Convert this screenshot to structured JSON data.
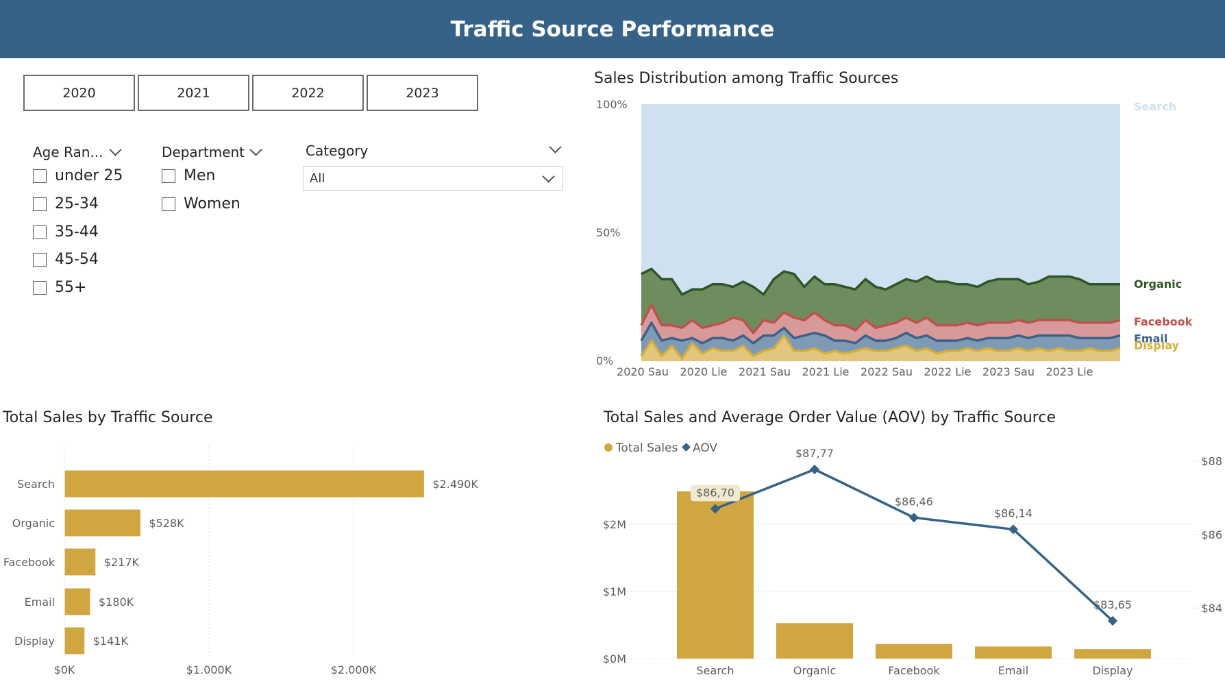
{
  "header": {
    "title": "Traffic Source Performance"
  },
  "year_buttons": [
    "2020",
    "2021",
    "2022",
    "2023"
  ],
  "slicers": {
    "age": {
      "title": "Age Ran...",
      "options": [
        "under 25",
        "25-34",
        "35-44",
        "45-54",
        "55+"
      ]
    },
    "department": {
      "title": "Department",
      "options": [
        "Men",
        "Women"
      ]
    },
    "category": {
      "title": "Category",
      "selected": "All"
    }
  },
  "colors": {
    "header": "#356286",
    "search": "#cfe0f1",
    "organic": "#2f5425",
    "organic_fill": "#6e8c5e",
    "facebook": "#c0504d",
    "facebook_fill": "#d8999a",
    "email": "#3c6288",
    "email_fill": "#7e9ab4",
    "display": "#d4ae3c",
    "display_fill": "#e3c67d",
    "bar": "#cfa640",
    "aov_line": "#356286"
  },
  "chart_data": [
    {
      "type": "area",
      "title": "Sales Distribution among Traffic Sources",
      "x_ticks": [
        "2020 Sau",
        "2020 Lie",
        "2021 Sau",
        "2021 Lie",
        "2022 Sau",
        "2022 Lie",
        "2023 Sau",
        "2023 Lie"
      ],
      "y_ticks": [
        "100%",
        "50%",
        "0%"
      ],
      "ylim": [
        0,
        100
      ],
      "stacked_percent": true,
      "series": [
        {
          "name": "Display",
          "values": [
            2,
            8,
            2,
            6,
            1,
            7,
            3,
            5,
            4,
            4,
            6,
            2,
            4,
            5,
            10,
            4,
            4,
            5,
            3,
            4,
            3,
            4,
            5,
            4,
            4,
            5,
            6,
            4,
            5,
            3,
            4,
            4,
            5,
            4,
            5,
            4,
            4,
            5,
            4,
            5,
            4,
            5,
            4,
            4,
            5,
            4,
            4,
            5
          ]
        },
        {
          "name": "Email",
          "values": [
            6,
            7,
            6,
            3,
            7,
            2,
            4,
            4,
            5,
            4,
            4,
            5,
            6,
            5,
            3,
            5,
            6,
            6,
            7,
            4,
            5,
            3,
            5,
            4,
            4,
            4,
            5,
            5,
            5,
            5,
            4,
            4,
            4,
            4,
            4,
            5,
            5,
            5,
            5,
            5,
            6,
            5,
            6,
            5,
            4,
            5,
            5,
            5
          ]
        },
        {
          "name": "Facebook",
          "values": [
            6,
            7,
            6,
            5,
            5,
            7,
            6,
            5,
            6,
            9,
            6,
            4,
            6,
            5,
            6,
            8,
            6,
            8,
            6,
            6,
            6,
            5,
            6,
            5,
            6,
            6,
            6,
            6,
            7,
            6,
            6,
            6,
            6,
            6,
            6,
            6,
            6,
            6,
            6,
            6,
            6,
            6,
            6,
            6,
            6,
            6,
            6,
            6
          ]
        },
        {
          "name": "Organic",
          "values": [
            20,
            14,
            18,
            18,
            13,
            12,
            15,
            16,
            15,
            12,
            15,
            18,
            10,
            17,
            16,
            17,
            13,
            14,
            14,
            16,
            15,
            16,
            16,
            16,
            14,
            15,
            15,
            16,
            16,
            17,
            17,
            16,
            15,
            15,
            16,
            17,
            17,
            16,
            15,
            15,
            17,
            17,
            17,
            17,
            15,
            15,
            15,
            14
          ]
        },
        {
          "name": "Search",
          "values": [
            66,
            64,
            68,
            68,
            74,
            72,
            72,
            70,
            70,
            71,
            69,
            71,
            74,
            68,
            65,
            66,
            71,
            67,
            70,
            70,
            71,
            72,
            68,
            71,
            72,
            70,
            68,
            69,
            67,
            69,
            69,
            70,
            70,
            71,
            69,
            68,
            68,
            68,
            70,
            69,
            67,
            67,
            67,
            68,
            70,
            70,
            70,
            70
          ]
        }
      ]
    },
    {
      "type": "bar",
      "orientation": "horizontal",
      "title": "Total Sales by Traffic Source",
      "categories": [
        "Search",
        "Organic",
        "Facebook",
        "Email",
        "Display"
      ],
      "values": [
        2490,
        528,
        217,
        180,
        141
      ],
      "labels": [
        "$2.490K",
        "$528K",
        "$217K",
        "$180K",
        "$141K"
      ],
      "x_ticks": [
        "$0K",
        "$1.000K",
        "$2.000K"
      ],
      "xlim": [
        0,
        2800
      ]
    },
    {
      "type": "bar",
      "title": "Total Sales and Average Order Value (AOV) by Traffic Source",
      "legend": [
        "Total Sales",
        "AOV"
      ],
      "categories": [
        "Search",
        "Organic",
        "Facebook",
        "Email",
        "Display"
      ],
      "series": [
        {
          "name": "Total Sales",
          "values": [
            2490,
            528,
            217,
            180,
            141
          ],
          "axis": "left",
          "ylim": [
            0,
            2800
          ]
        },
        {
          "name": "AOV",
          "type": "line",
          "values": [
            86.7,
            87.77,
            86.46,
            86.14,
            83.65
          ],
          "labels": [
            "$86,70",
            "$87,77",
            "$86,46",
            "$86,14",
            "$83,65"
          ],
          "axis": "right",
          "ylim": [
            83.0,
            88.0
          ]
        }
      ],
      "left_ticks": [
        "$0M",
        "$1M",
        "$2M"
      ],
      "right_ticks": [
        "$84",
        "$86",
        "$88"
      ]
    }
  ]
}
